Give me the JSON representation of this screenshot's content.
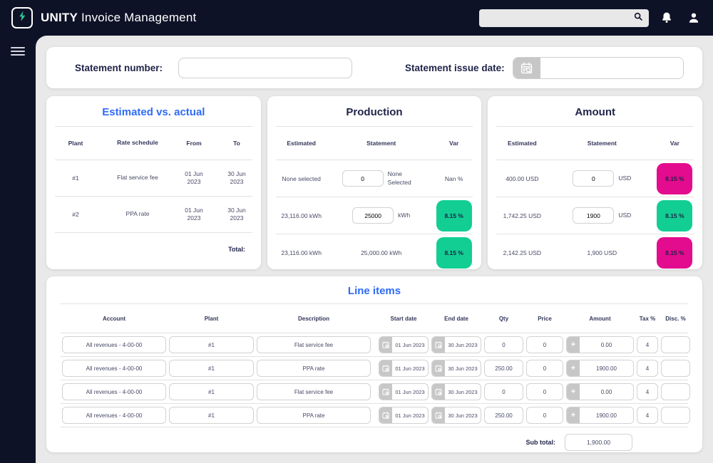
{
  "colors": {
    "navy": "#0e1227",
    "page_bg": "#e9e9e9",
    "accent_blue": "#2e6bf6",
    "badge_green": "#13ce92",
    "badge_pink": "#e30b8e",
    "gray_button": "#c7c7c7",
    "text_dark": "#1f2348"
  },
  "icons": {
    "plus": "+"
  },
  "header": {
    "brand_bold": "UNITY",
    "brand_rest": "Invoice Management",
    "search_value": ""
  },
  "statement_bar": {
    "number_label": "Statement number:",
    "number_value": "",
    "issue_date_label": "Statement issue date:",
    "issue_date_value": ""
  },
  "estimated_vs_actual": {
    "title": "Estimated vs. actual",
    "columns": [
      "Plant",
      "Rate schedule",
      "From",
      "To"
    ],
    "rows": [
      {
        "plant": "#1",
        "rate_schedule": "Flat service fee",
        "from": "01 Jun 2023",
        "to": "30 Jun 2023"
      },
      {
        "plant": "#2",
        "rate_schedule": "PPA rate",
        "from": "01 Jun 2023",
        "to": "30 Jun 2023"
      }
    ],
    "total_label": "Total:"
  },
  "production": {
    "title": "Production",
    "columns": [
      "Estimated",
      "Statement",
      "Var"
    ],
    "rows": [
      {
        "estimated": "None selected",
        "input": "0",
        "unit": "None Selected",
        "var": "Nan %",
        "badge": "badge-none"
      },
      {
        "estimated": "23,116.00 kWh",
        "input": "25000",
        "unit": "kWh",
        "var": "8.15 %",
        "badge": "badge-green"
      },
      {
        "estimated": "23,116.00 kWh",
        "statement_text": "25,000.00 kWh",
        "var": "8.15 %",
        "badge": "badge-green"
      }
    ]
  },
  "amount": {
    "title": "Amount",
    "columns": [
      "Estimated",
      "Statement",
      "Var"
    ],
    "rows": [
      {
        "estimated": "400.00 USD",
        "input": "0",
        "unit": "USD",
        "var": "8.15 %",
        "badge": "badge-pink"
      },
      {
        "estimated": "1,742.25 USD",
        "input": "1900",
        "unit": "USD",
        "var": "8.15 %",
        "badge": "badge-green"
      },
      {
        "estimated": "2,142.25 USD",
        "statement_text": "1,900 USD",
        "var": "8.15 %",
        "badge": "badge-pink"
      }
    ]
  },
  "line_items": {
    "title": "Line items",
    "columns": [
      "Account",
      "Plant",
      "Description",
      "Start date",
      "End date",
      "Qty",
      "Price",
      "Amount",
      "Tax %",
      "Disc. %"
    ],
    "rows": [
      {
        "account": "All revenues - 4-00-00",
        "plant": "#1",
        "description": "Flat service fee",
        "start_date": "01 Jun 2023",
        "end_date": "30 Jun 2023",
        "qty": "0",
        "price": "0",
        "amount": "0.00",
        "tax": "4",
        "disc": ""
      },
      {
        "account": "All revenues - 4-00-00",
        "plant": "#1",
        "description": "PPA rate",
        "start_date": "01 Jun 2023",
        "end_date": "30 Jun 2023",
        "qty": "250.00",
        "price": "0",
        "amount": "1900.00",
        "tax": "4",
        "disc": ""
      },
      {
        "account": "All revenues - 4-00-00",
        "plant": "#1",
        "description": "Flat service fee",
        "start_date": "01 Jun 2023",
        "end_date": "30 Jun 2023",
        "qty": "0",
        "price": "0",
        "amount": "0.00",
        "tax": "4",
        "disc": ""
      },
      {
        "account": "All revenues - 4-00-00",
        "plant": "#1",
        "description": "PPA rate",
        "start_date": "01 Jun 2023",
        "end_date": "30 Jun 2023",
        "qty": "250.00",
        "price": "0",
        "amount": "1900.00",
        "tax": "4",
        "disc": ""
      }
    ],
    "subtotal_label": "Sub total:",
    "subtotal_value": "1,900.00"
  }
}
